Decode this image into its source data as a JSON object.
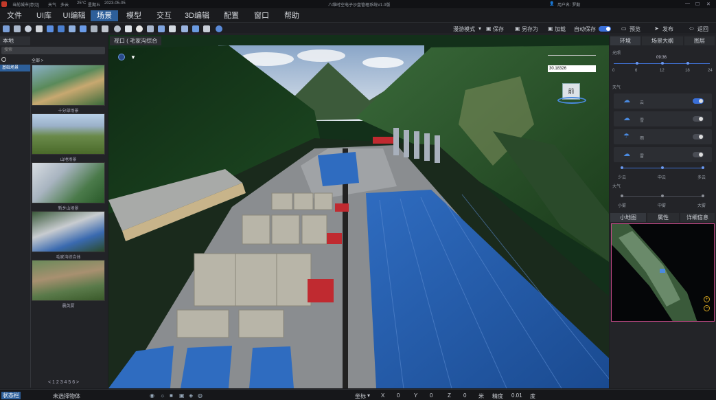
{
  "titlebar": {
    "left_label": "当前城市[意见]",
    "weather_label": "天气",
    "weather": "多云",
    "temp": "25°C",
    "weekday": "星期五",
    "date": "2023-05-05",
    "app_title": "八维时空电子沙盘管理系统V1.0版",
    "user": "用户名: 罗勤"
  },
  "menu": [
    "文件",
    "UI库",
    "UI编辑",
    "场景",
    "模型",
    "交互",
    "3D编辑",
    "配置",
    "窗口",
    "帮助"
  ],
  "toolbar": {
    "mode": "漫游模式",
    "save": "保存",
    "save_as": "另存为",
    "load": "加载",
    "autosave": "自动保存",
    "preview": "预览",
    "publish": "发布",
    "back": "返回"
  },
  "left": {
    "tab": "本地",
    "search_placeholder": "搜索",
    "all": "全部 >",
    "category": "基础场景",
    "thumbs": [
      "十分部场景",
      "山地场景",
      "新乡山场景",
      "毛家沟综合体",
      "晨英厨"
    ],
    "pager": "< 1 2 3 4 5 6 >"
  },
  "viewport": {
    "tab": "视口 ( 毛家沟综合",
    "compass_value": "30.18326",
    "cube_face": "前"
  },
  "right": {
    "tabs": [
      "环境",
      "场景大纲",
      "图层"
    ],
    "light_label": "光照",
    "time": "09:36",
    "time_ticks": [
      "0",
      "6",
      "12",
      "18",
      "24"
    ],
    "weather_label": "天气",
    "weather_items": [
      {
        "name": "云",
        "on": true
      },
      {
        "name": "雪",
        "on": false
      },
      {
        "name": "雨",
        "on": false
      },
      {
        "name": "雷",
        "on": false
      }
    ],
    "cloud_ticks": [
      "少云",
      "中云",
      "多云"
    ],
    "fog_label": "大气",
    "fog_ticks": [
      "小雾",
      "中雾",
      "大雾"
    ],
    "bottom_tabs": [
      "小地图",
      "属性",
      "详细信息"
    ]
  },
  "status": {
    "left": "状态栏",
    "selection": "未选择物体",
    "coord_label": "坐标",
    "x_label": "X",
    "x": "0",
    "y_label": "Y",
    "y": "0",
    "z_label": "Z",
    "z": "0",
    "unit": "米",
    "precision_label": "精度",
    "precision": "0.01",
    "deg": "度"
  }
}
